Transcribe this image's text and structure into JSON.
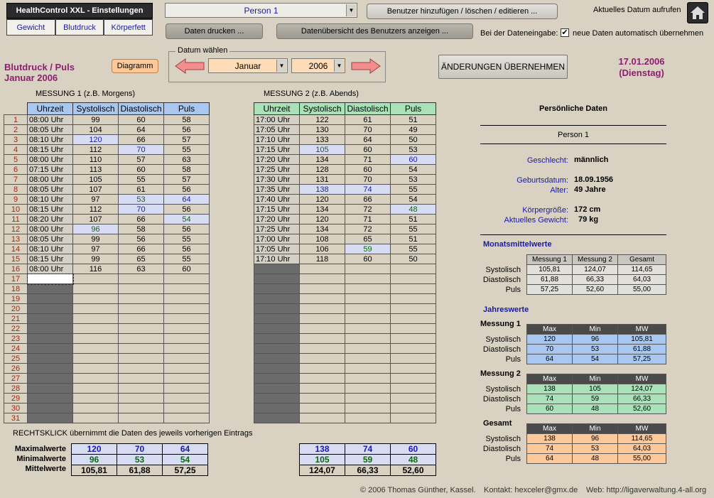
{
  "header": {
    "app_title": "HealthControl XXL - Einstellungen",
    "tabs": [
      "Gewicht",
      "Blutdruck",
      "Körperfett"
    ],
    "person_select": "Person 1",
    "manage_users_button": "Benutzer hinzufügen / löschen / editieren ...",
    "print_button": "Daten drucken ...",
    "overview_button": "Datenübersicht des Benutzers anzeigen ...",
    "current_date_label": "Aktuelles Datum aufrufen",
    "auto_accept_label": "Bei der Dateneingabe:",
    "auto_accept_checkbox": "neue Daten automatisch übernehmen",
    "auto_accept_checked": true
  },
  "left_panel": {
    "title": "Blutdruck / Puls",
    "subtitle": "Januar  2006",
    "diagram_button": "Diagramm"
  },
  "date_picker": {
    "legend": "Datum wählen",
    "month": "Januar",
    "year": "2006"
  },
  "apply_button": "ÄNDERUNGEN ÜBERNEHMEN",
  "current_date": {
    "date": "17.01.2006",
    "weekday": "(Dienstag)"
  },
  "measurement1": {
    "label": "MESSUNG 1 (z.B. Morgens)",
    "headers": [
      "Uhrzeit",
      "Systolisch",
      "Diastolisch",
      "Puls"
    ],
    "rows": [
      [
        "08:00 Uhr",
        "99",
        "60",
        "58"
      ],
      [
        "08:05 Uhr",
        "104",
        "64",
        "56"
      ],
      [
        "08:10 Uhr",
        "120",
        "66",
        "57"
      ],
      [
        "08:15 Uhr",
        "112",
        "70",
        "55"
      ],
      [
        "08:00 Uhr",
        "110",
        "57",
        "63"
      ],
      [
        "07:15 Uhr",
        "113",
        "60",
        "58"
      ],
      [
        "08:00 Uhr",
        "105",
        "55",
        "57"
      ],
      [
        "08:05 Uhr",
        "107",
        "61",
        "56"
      ],
      [
        "08:10 Uhr",
        "97",
        "53",
        "64"
      ],
      [
        "08:15 Uhr",
        "112",
        "70",
        "56"
      ],
      [
        "08:20 Uhr",
        "107",
        "66",
        "54"
      ],
      [
        "08:00 Uhr",
        "96",
        "58",
        "56"
      ],
      [
        "08:05 Uhr",
        "99",
        "56",
        "55"
      ],
      [
        "08:10 Uhr",
        "97",
        "66",
        "56"
      ],
      [
        "08:15 Uhr",
        "99",
        "65",
        "55"
      ],
      [
        "08:00 Uhr",
        "116",
        "63",
        "60"
      ]
    ]
  },
  "measurement2": {
    "label": "MESSUNG 2 (z.B. Abends)",
    "headers": [
      "Uhrzeit",
      "Systolisch",
      "Diastolisch",
      "Puls"
    ],
    "rows": [
      [
        "17:00 Uhr",
        "122",
        "61",
        "51"
      ],
      [
        "17:05 Uhr",
        "130",
        "70",
        "49"
      ],
      [
        "17:10 Uhr",
        "133",
        "64",
        "50"
      ],
      [
        "17:15 Uhr",
        "105",
        "60",
        "53"
      ],
      [
        "17:20 Uhr",
        "134",
        "71",
        "60"
      ],
      [
        "17:25 Uhr",
        "128",
        "60",
        "54"
      ],
      [
        "17:30 Uhr",
        "131",
        "70",
        "53"
      ],
      [
        "17:35 Uhr",
        "138",
        "74",
        "55"
      ],
      [
        "17:40 Uhr",
        "120",
        "66",
        "54"
      ],
      [
        "17:15 Uhr",
        "134",
        "72",
        "48"
      ],
      [
        "17:20 Uhr",
        "120",
        "71",
        "51"
      ],
      [
        "17:25 Uhr",
        "134",
        "72",
        "55"
      ],
      [
        "17:00 Uhr",
        "108",
        "65",
        "51"
      ],
      [
        "17:05 Uhr",
        "106",
        "59",
        "55"
      ],
      [
        "17:10 Uhr",
        "118",
        "60",
        "50"
      ]
    ]
  },
  "days": [
    "1",
    "2",
    "3",
    "4",
    "5",
    "6",
    "7",
    "8",
    "9",
    "10",
    "11",
    "12",
    "13",
    "14",
    "15",
    "16",
    "17",
    "18",
    "19",
    "20",
    "21",
    "22",
    "23",
    "24",
    "25",
    "26",
    "27",
    "28",
    "29",
    "30",
    "31"
  ],
  "note": "RECHTSKLICK übernimmt die Daten des jeweils vorherigen Eintrags",
  "summary": {
    "labels": [
      "Maximalwerte",
      "Minimalwerte",
      "Mittelwerte"
    ],
    "m1": [
      [
        "120",
        "70",
        "64"
      ],
      [
        "96",
        "53",
        "54"
      ],
      [
        "105,81",
        "61,88",
        "57,25"
      ]
    ],
    "m2": [
      [
        "138",
        "74",
        "60"
      ],
      [
        "105",
        "59",
        "48"
      ],
      [
        "124,07",
        "66,33",
        "52,60"
      ]
    ]
  },
  "personal": {
    "heading": "Persönliche Daten",
    "name": "Person 1",
    "gender_label": "Geschlecht:",
    "gender": "männlich",
    "birth_label": "Geburtsdatum:",
    "birth": "18.09.1956",
    "age_label": "Alter:",
    "age": "49 Jahre",
    "height_label": "Körpergröße:",
    "height": "172 cm",
    "weight_label": "Aktuelles Gewicht:",
    "weight": "79 kg"
  },
  "month_avg": {
    "heading": "Monatsmittelwerte",
    "cols": [
      "Messung 1",
      "Messung 2",
      "Gesamt"
    ],
    "row_labels": [
      "Systolisch",
      "Diastolisch",
      "Puls"
    ],
    "rows": [
      [
        "105,81",
        "124,07",
        "114,65"
      ],
      [
        "61,88",
        "66,33",
        "64,03"
      ],
      [
        "57,25",
        "52,60",
        "55,00"
      ]
    ]
  },
  "year_values": {
    "heading": "Jahreswerte",
    "cols": [
      "Max",
      "Min",
      "MW"
    ],
    "row_labels": [
      "Systolisch",
      "Diastolisch",
      "Puls"
    ],
    "m1_label": "Messung 1",
    "m1": [
      [
        "120",
        "96",
        "105,81"
      ],
      [
        "70",
        "53",
        "61,88"
      ],
      [
        "64",
        "54",
        "57,25"
      ]
    ],
    "m2_label": "Messung 2",
    "m2": [
      [
        "138",
        "105",
        "124,07"
      ],
      [
        "74",
        "59",
        "66,33"
      ],
      [
        "60",
        "48",
        "52,60"
      ]
    ],
    "total_label": "Gesamt",
    "total": [
      [
        "138",
        "96",
        "114,65"
      ],
      [
        "74",
        "53",
        "64,03"
      ],
      [
        "64",
        "48",
        "55,00"
      ]
    ]
  },
  "footer": {
    "copyright": "© 2006 Thomas Günther, Kassel.",
    "contact": "Kontakt: hexceler@gmx.de",
    "web": "Web: http://ligaverwaltung.4-all.org"
  },
  "colors": {
    "title_purple": "#8b1e6e",
    "link_blue": "#1a1aa0",
    "header_blue": "#a8c8f2",
    "header_green": "#a9e2b8",
    "year_m1": "#a8c8f2",
    "year_m2": "#a9e2b8",
    "year_total": "#fdc89a"
  }
}
